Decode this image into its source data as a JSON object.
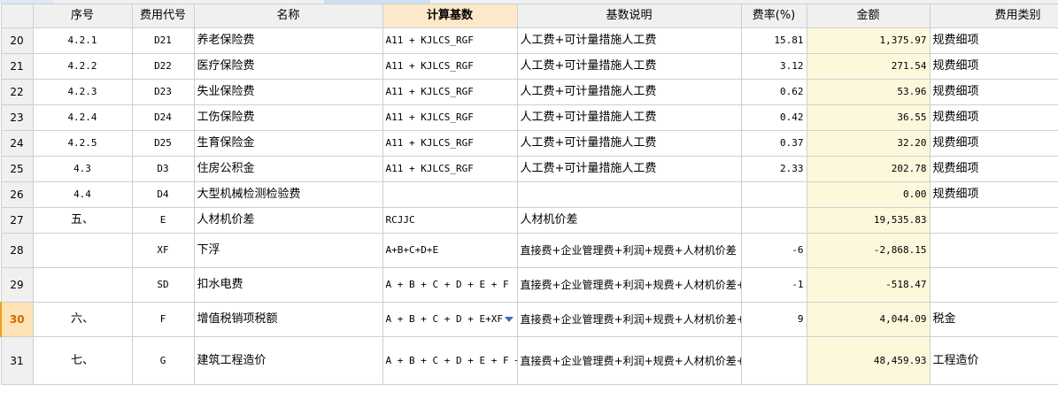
{
  "headers": {
    "seq": "序号",
    "code": "费用代号",
    "name": "名称",
    "base": "计算基数",
    "desc": "基数说明",
    "rate": "费率(%)",
    "amount": "金额",
    "type": "费用类别"
  },
  "rows": [
    {
      "num": "20",
      "seq": "4.2.1",
      "code": "D21",
      "name": "养老保险费",
      "base": "A11 + KJLCS_RGF",
      "desc": "人工费+可计量措施人工费",
      "rate": "15.81",
      "amount": "1,375.97",
      "type": "规费细项"
    },
    {
      "num": "21",
      "seq": "4.2.2",
      "code": "D22",
      "name": "医疗保险费",
      "base": "A11 + KJLCS_RGF",
      "desc": "人工费+可计量措施人工费",
      "rate": "3.12",
      "amount": "271.54",
      "type": "规费细项"
    },
    {
      "num": "22",
      "seq": "4.2.3",
      "code": "D23",
      "name": "失业保险费",
      "base": "A11 + KJLCS_RGF",
      "desc": "人工费+可计量措施人工费",
      "rate": "0.62",
      "amount": "53.96",
      "type": "规费细项"
    },
    {
      "num": "23",
      "seq": "4.2.4",
      "code": "D24",
      "name": "工伤保险费",
      "base": "A11 + KJLCS_RGF",
      "desc": "人工费+可计量措施人工费",
      "rate": "0.42",
      "amount": "36.55",
      "type": "规费细项"
    },
    {
      "num": "24",
      "seq": "4.2.5",
      "code": "D25",
      "name": "生育保险金",
      "base": "A11 + KJLCS_RGF",
      "desc": "人工费+可计量措施人工费",
      "rate": "0.37",
      "amount": "32.20",
      "type": "规费细项"
    },
    {
      "num": "25",
      "seq": "4.3",
      "code": "D3",
      "name": "住房公积金",
      "base": "A11 + KJLCS_RGF",
      "desc": "人工费+可计量措施人工费",
      "rate": "2.33",
      "amount": "202.78",
      "type": "规费细项"
    },
    {
      "num": "26",
      "seq": "4.4",
      "code": "D4",
      "name": "大型机械检测检验费",
      "base": "",
      "desc": "",
      "rate": "",
      "amount": "0.00",
      "type": "规费细项"
    },
    {
      "num": "27",
      "seq": "五、",
      "code": "E",
      "name": "人材机价差",
      "base": "RCJJC",
      "desc": "人材机价差",
      "rate": "",
      "amount": "19,535.83",
      "type": ""
    },
    {
      "num": "28",
      "seq": "",
      "code": "XF",
      "name": "下浮",
      "base": "A+B+C+D+E",
      "desc": "直接费+企业管理费+利润+规费+人材机价差",
      "rate": "-6",
      "amount": "-2,868.15",
      "type": ""
    },
    {
      "num": "29",
      "seq": "",
      "code": "SD",
      "name": "扣水电费",
      "base": "A + B + C + D + E + F",
      "desc": "直接费+企业管理费+利润+规费+人材机价差+增值税销项税额",
      "rate": "-1",
      "amount": "-518.47",
      "type": ""
    },
    {
      "num": "30",
      "seq": "六、",
      "code": "F",
      "name": "增值税销项税额",
      "base": "A + B + C + D + E+XF",
      "desc": "直接费+企业管理费+利润+规费+人材机价差+下浮",
      "rate": "9",
      "amount": "4,044.09",
      "type": "税金"
    },
    {
      "num": "31",
      "seq": "七、",
      "code": "G",
      "name": "建筑工程造价",
      "base": "A + B + C + D + E + F + XF + SD",
      "desc": "直接费+企业管理费+利润+规费+人材机价差+增值税销项税额+下浮+扣水电费",
      "rate": "",
      "amount": "48,459.93",
      "type": "工程造价"
    }
  ],
  "active_row": "30",
  "selected_column": "计算基数",
  "colors": {
    "header_bg": "#f0f0f0",
    "selected_header_bg": "#fde9c9",
    "amount_bg": "#fdf7dc",
    "active_row_marker": "#f0a020"
  }
}
